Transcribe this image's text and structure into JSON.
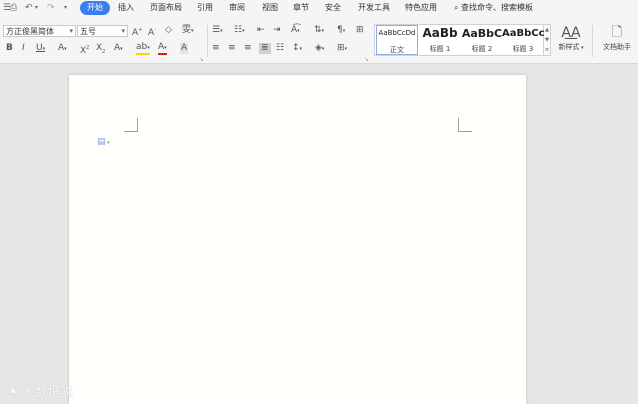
{
  "menubar": {
    "tabs": [
      {
        "label": "开始",
        "active": true
      },
      {
        "label": "插入"
      },
      {
        "label": "页面布局"
      },
      {
        "label": "引用"
      },
      {
        "label": "审阅"
      },
      {
        "label": "视图"
      },
      {
        "label": "章节"
      },
      {
        "label": "安全"
      },
      {
        "label": "开发工具"
      },
      {
        "label": "特色应用"
      }
    ],
    "search_label": "查找命令、搜索模板"
  },
  "ribbon": {
    "font_name": "方正俊黑简体",
    "font_size": "五号",
    "styles": [
      {
        "preview": "AaBbCcDd",
        "name": "正文",
        "current": true
      },
      {
        "preview": "AaBb",
        "name": "标题 1"
      },
      {
        "preview": "AaBbC",
        "name": "标题 2"
      },
      {
        "preview": "AaBbCc",
        "name": "标题 3"
      }
    ],
    "new_style_label": "新样式",
    "doc_helper_label": "文档助手"
  },
  "watermark": "大数据说",
  "colors": {
    "accent": "#3b7ded",
    "highlight": "#f5d800",
    "font_color": "#d82020"
  }
}
